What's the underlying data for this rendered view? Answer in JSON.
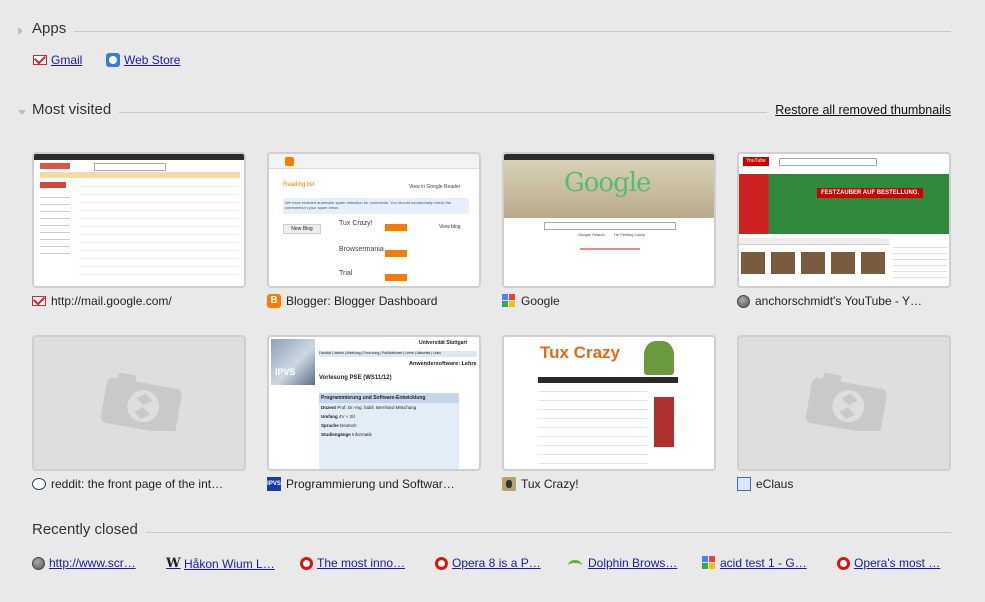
{
  "apps": {
    "title": "Apps",
    "items": [
      {
        "label": "Gmail",
        "icon": "gmail-icon"
      },
      {
        "label": "Web Store",
        "icon": "web-store-icon"
      }
    ]
  },
  "most_visited": {
    "title": "Most visited",
    "restore_label": "Restore all removed thumbnails",
    "tiles": [
      {
        "label": "http://mail.google.com/",
        "icon": "gmail-icon"
      },
      {
        "label": "Blogger: Blogger Dashboard",
        "icon": "blogger-icon",
        "thumb_text": {
          "reading": "Reading list",
          "view_google": "View in Google Reader",
          "notice": "We have enabled automatic spam detection for comments. You should occasionally check the comments in your spam inbox.",
          "new_blog": "New Blog",
          "blogs": [
            "Tux Crazy!",
            "Browsermania",
            "Trial"
          ],
          "view_blog": "View blog"
        }
      },
      {
        "label": "Google",
        "icon": "google-icon",
        "thumb_text": {
          "logo": "Google",
          "search": "Google Search",
          "lucky": "I'm Feeling Lucky"
        }
      },
      {
        "label": "anchorschmidt's YouTube - Y…",
        "icon": "globe-icon",
        "thumb_text": {
          "banner": "FESTZAUBER AUF BESTELLUNG.",
          "logo": "YouTube"
        }
      },
      {
        "label": "reddit: the front page of the int…",
        "icon": "reddit-icon"
      },
      {
        "label": "Programmierung und Softwar…",
        "icon": "ipvs-icon",
        "thumb_text": {
          "uni": "Universität Stuttgart",
          "nav": "Fakultät | Institut | Abteilung | Forschung | Publikationen | Lehre | Aktuelles | Links",
          "section": "Anwendersoftware: Lehre",
          "course": "Vorlesung PSE (WS11/12)",
          "box_title": "Programmierung und Software-Entwicklung",
          "rows": [
            [
              "Dozent",
              "Prof. Dr.-Ing. habil. Bernhard Mitschang"
            ],
            [
              "Umfang",
              "4V + 2Ü"
            ],
            [
              "Sprache",
              "Deutsch"
            ],
            [
              "Studiengänge",
              "Informatik"
            ]
          ],
          "ipvs": "IPVS"
        }
      },
      {
        "label": "Tux Crazy!",
        "icon": "tux-icon",
        "thumb_text": {
          "title": "Tux Crazy"
        }
      },
      {
        "label": "eClaus",
        "icon": "eclaus-icon"
      }
    ]
  },
  "recently_closed": {
    "title": "Recently closed",
    "items": [
      {
        "label": "http://www.scr…",
        "icon": "globe-icon"
      },
      {
        "label": "Håkon Wium L…",
        "icon": "wikipedia-icon"
      },
      {
        "label": "The most inno…",
        "icon": "opera-icon"
      },
      {
        "label": "Opera 8 is a P…",
        "icon": "opera-icon"
      },
      {
        "label": "Dolphin Brows…",
        "icon": "dolphin-icon"
      },
      {
        "label": "acid test 1 - G…",
        "icon": "google-icon"
      },
      {
        "label": "Opera's most …",
        "icon": "opera-icon"
      }
    ]
  }
}
